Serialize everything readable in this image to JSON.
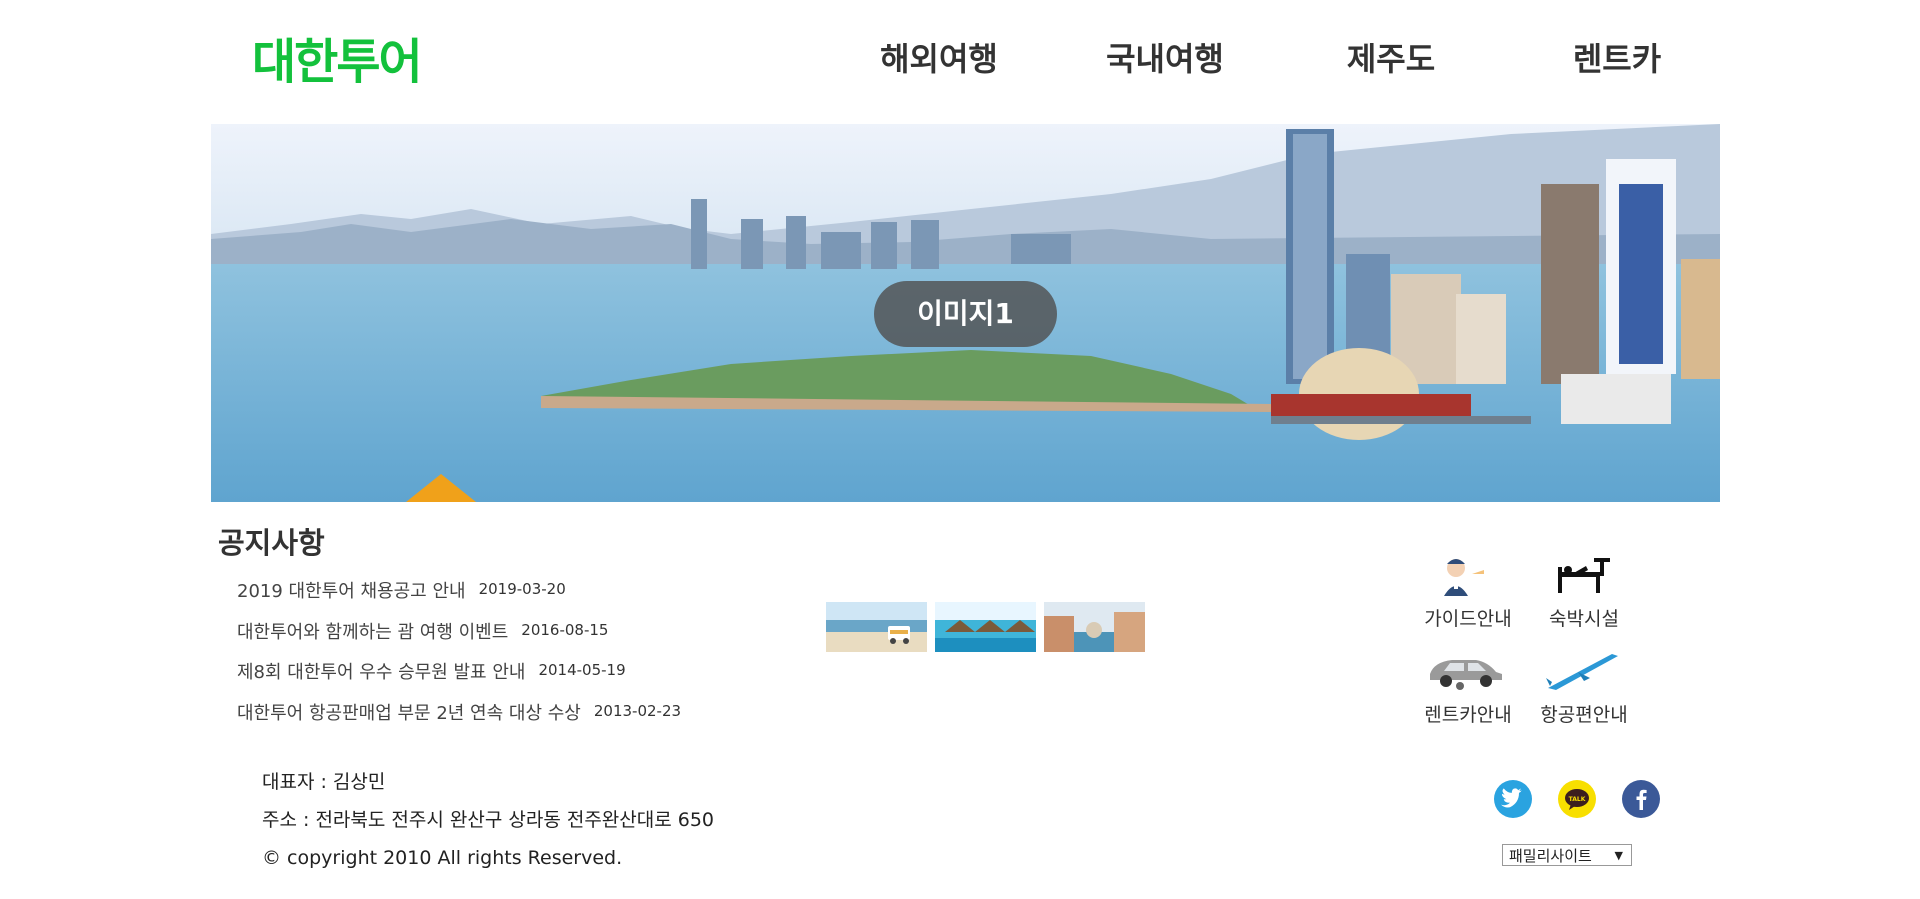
{
  "header": {
    "logo": "대한투어",
    "nav": [
      {
        "label": "해외여행"
      },
      {
        "label": "국내여행"
      },
      {
        "label": "제주도"
      },
      {
        "label": "렌트카"
      }
    ]
  },
  "hero": {
    "caption": "이미지1"
  },
  "notice": {
    "title": "공지사항",
    "items": [
      {
        "text": "2019 대한투어 채용공고 안내",
        "date": "2019-03-20"
      },
      {
        "text": "대한투어와 함께하는 괌 여행 이벤트",
        "date": "2016-08-15"
      },
      {
        "text": "제8회 대한투어 우수 승무원 발표 안내",
        "date": "2014-05-19"
      },
      {
        "text": "대한투어 항공판매업 부문 2년 연속 대상 수상",
        "date": "2013-02-23"
      }
    ]
  },
  "gallery": {
    "icons": [
      "beach-camper-photo",
      "overwater-villa-photo",
      "venice-canal-photo"
    ]
  },
  "quick_menu": {
    "items": [
      {
        "label": "가이드안내",
        "icon": "guide-icon"
      },
      {
        "label": "숙박시설",
        "icon": "bed-icon"
      },
      {
        "label": "렌트카안내",
        "icon": "car-icon"
      },
      {
        "label": "항공편안내",
        "icon": "airplane-icon"
      }
    ]
  },
  "footer": {
    "representative": "대표자 : 김상민",
    "address": "주소 : 전라북도 전주시 완산구 상라동 전주완산대로 650",
    "copyright": "© copyright 2010 All rights Reserved."
  },
  "social": {
    "twitter_color": "#2aa3e0",
    "kakao_color": "#f8df00",
    "kakao_text": "TALK",
    "facebook_color": "#3b5998"
  },
  "family_site": {
    "selected": "패밀리사이트",
    "arrow": "▼"
  },
  "colors": {
    "logo": "#13c13c",
    "text": "#333333"
  }
}
